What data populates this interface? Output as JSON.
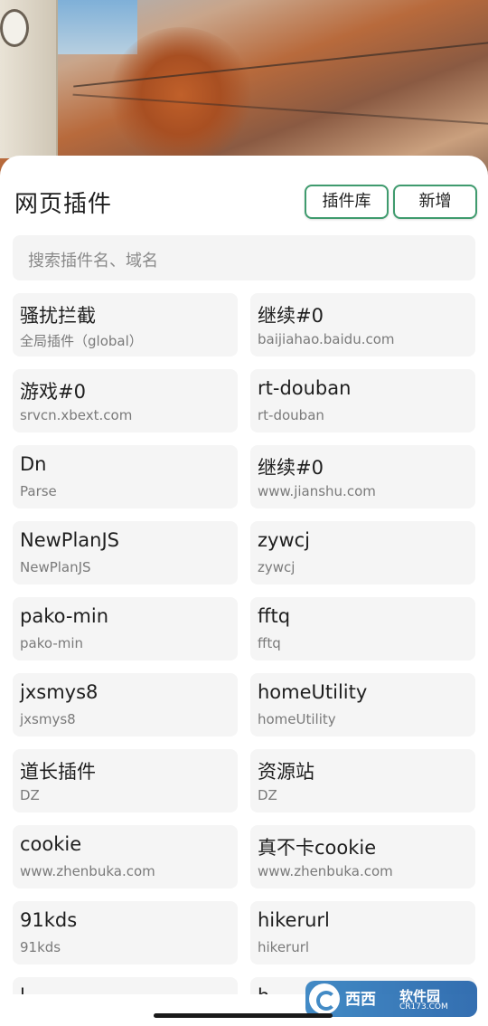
{
  "header": {
    "title": "网页插件",
    "library_button": "插件库",
    "add_button": "新增"
  },
  "search": {
    "placeholder": "搜索插件名、域名"
  },
  "plugins": [
    {
      "name": "骚扰拦截",
      "domain": "全局插件（global）"
    },
    {
      "name": "继续#0",
      "domain": "baijiahao.baidu.com"
    },
    {
      "name": "游戏#0",
      "domain": "srvcn.xbext.com"
    },
    {
      "name": "rt-douban",
      "domain": "rt-douban"
    },
    {
      "name": "Dn",
      "domain": "Parse"
    },
    {
      "name": "继续#0",
      "domain": "www.jianshu.com"
    },
    {
      "name": "NewPlanJS",
      "domain": "NewPlanJS"
    },
    {
      "name": "zywcj",
      "domain": "zywcj"
    },
    {
      "name": "pako-min",
      "domain": "pako-min"
    },
    {
      "name": "fftq",
      "domain": "fftq"
    },
    {
      "name": "jxsmys8",
      "domain": "jxsmys8"
    },
    {
      "name": "homeUtility",
      "domain": "homeUtility"
    },
    {
      "name": "道长插件",
      "domain": "DZ"
    },
    {
      "name": "资源站",
      "domain": "DZ"
    },
    {
      "name": "cookie",
      "domain": "www.zhenbuka.com"
    },
    {
      "name": "真不卡cookie",
      "domain": "www.zhenbuka.com"
    },
    {
      "name": "91kds",
      "domain": "91kds"
    },
    {
      "name": "hikerurl",
      "domain": "hikerurl"
    },
    {
      "name": "l...",
      "domain": ""
    },
    {
      "name": "h...",
      "domain": ""
    }
  ],
  "watermark": {
    "brand": "西西",
    "site": "软件园",
    "url": "CR173.COM"
  },
  "colors": {
    "accent": "#3f9b6e",
    "card_bg": "#f5f5f5",
    "search_bg": "#f4f4f4"
  }
}
